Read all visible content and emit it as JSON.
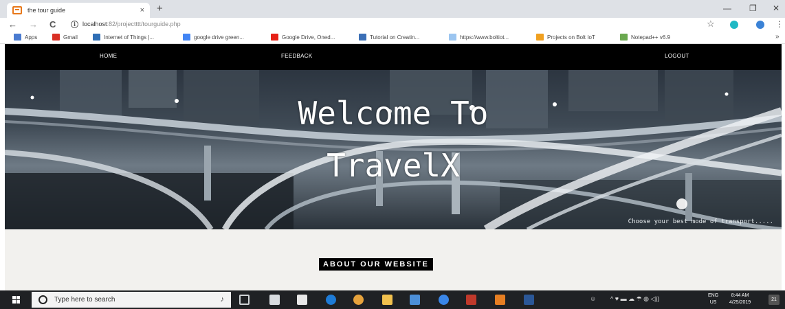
{
  "browser": {
    "tab_title": "the tour guide",
    "tab_close": "×",
    "new_tab": "+",
    "window_controls": {
      "minimize": "—",
      "restore": "❐",
      "close": "✕"
    },
    "nav": {
      "back": "←",
      "forward": "→",
      "reload": "C"
    },
    "url_host": "localhost",
    "url_rest": ":82/projectttt/tourguide.php",
    "bookmarks": [
      {
        "label": "Apps",
        "icon": "apps-grid-icon",
        "color": "#4a7bd0"
      },
      {
        "label": "Gmail",
        "icon": "gmail-icon",
        "color": "#d93025"
      },
      {
        "label": "Internet of Things |...",
        "icon": "iot-icon",
        "color": "#2f6eb5"
      },
      {
        "label": "google drive green...",
        "icon": "google-icon",
        "color": "#4285f4"
      },
      {
        "label": "Google Drive, Oned...",
        "icon": "youtube-icon",
        "color": "#e62117"
      },
      {
        "label": "Tutorial on Creatin...",
        "icon": "chart-icon",
        "color": "#3b6fb6"
      },
      {
        "label": "https://www.boltiot...",
        "icon": "page-icon",
        "color": "#9bc5f0"
      },
      {
        "label": "Projects on Bolt IoT",
        "icon": "bolt-icon",
        "color": "#f0a020"
      },
      {
        "label": "Notepad++ v6.9",
        "icon": "notepad-icon",
        "color": "#6aa84f"
      }
    ],
    "bookmarks_more": "»",
    "menu_icon": "⋮"
  },
  "site": {
    "nav": {
      "home": "HOME",
      "feedback": "FEEDBACK",
      "logout": "LOGOUT"
    },
    "hero": {
      "line1": "Welcome To",
      "line2": "TravelX",
      "subtitle": "Choose your best mode of transport....."
    },
    "about_label": "ABOUT OUR WEBSITE"
  },
  "taskbar": {
    "search_placeholder": "Type here to search",
    "tray_text": "^ ♥ ▬ ☁ ☂ ◍ ◁))",
    "lang_top": "ENG",
    "lang_bottom": "US",
    "time": "8:44 AM",
    "date": "4/25/2019",
    "notification_count": "21",
    "apps": [
      {
        "icon": "task-view-icon",
        "color": "#cfd3d6"
      },
      {
        "icon": "network-folder-icon",
        "color": "#d9dce0"
      },
      {
        "icon": "store-icon",
        "color": "#e8e8e8"
      },
      {
        "icon": "edge-icon",
        "color": "#1e7bd6"
      },
      {
        "icon": "chrome-icon",
        "color": "#e6a23c"
      },
      {
        "icon": "file-explorer-icon",
        "color": "#f2c14e"
      },
      {
        "icon": "app-icon",
        "color": "#4c8fd8"
      },
      {
        "icon": "globe-icon",
        "color": "#3a86e8"
      },
      {
        "icon": "red-app-icon",
        "color": "#c0392b"
      },
      {
        "icon": "orange-app-icon",
        "color": "#e67e22"
      },
      {
        "icon": "word-icon",
        "color": "#2b5797"
      }
    ]
  }
}
